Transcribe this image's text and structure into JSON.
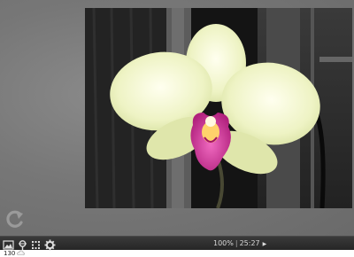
{
  "viewer": {
    "zoom": "100%",
    "time": "25:27",
    "play_symbol": "▶"
  },
  "toolbar": {
    "icons": [
      "image-icon",
      "pin-icon",
      "grid-icon",
      "gear-icon"
    ],
    "rotate_icon": "rotate-icon"
  },
  "footer": {
    "count": "130",
    "icon": "cloud-icon"
  },
  "colors": {
    "background": "#777777",
    "toolbar": "#2e2e2e",
    "orchid_petal": "#f0f3c8",
    "orchid_lip": "#d23a9a"
  }
}
